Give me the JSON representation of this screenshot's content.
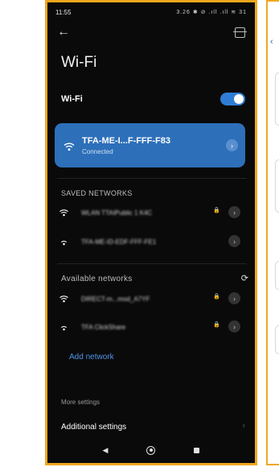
{
  "status_bar": {
    "time": "11:55",
    "indicators": "3.26 ✱ ⊘ .ıll .ıll ≋ 31"
  },
  "header": {
    "back_icon": "back-arrow-icon",
    "scan_icon": "qr-scan-icon"
  },
  "page_title": "Wi-Fi",
  "wifi_toggle": {
    "label": "Wi-Fi",
    "enabled": true,
    "accent": "#2f7dd5"
  },
  "connected_network": {
    "name": "TFA-ME-I...F-FFF-F83",
    "status": "Connected",
    "card_color": "#2d6fb9"
  },
  "saved_networks": {
    "heading": "SAVED NETWORKS",
    "items": [
      {
        "name": "WLAN TTAIPublic 1 K4C",
        "locked": true
      },
      {
        "name": "TFA-ME-ID-EDF-FFF-FE1",
        "locked": false
      }
    ]
  },
  "available_networks": {
    "heading": "Available networks",
    "items": [
      {
        "name": "DIRECT-m...mod_A7YF",
        "locked": true
      },
      {
        "name": "TFA ClickShare",
        "locked": true
      }
    ]
  },
  "add_network_label": "Add network",
  "more_settings": {
    "heading": "More settings",
    "additional_label": "Additional settings"
  },
  "navbar": {
    "back": "◀",
    "home": "home-circle",
    "recents": "square"
  },
  "frame_color": "#f0a71e"
}
